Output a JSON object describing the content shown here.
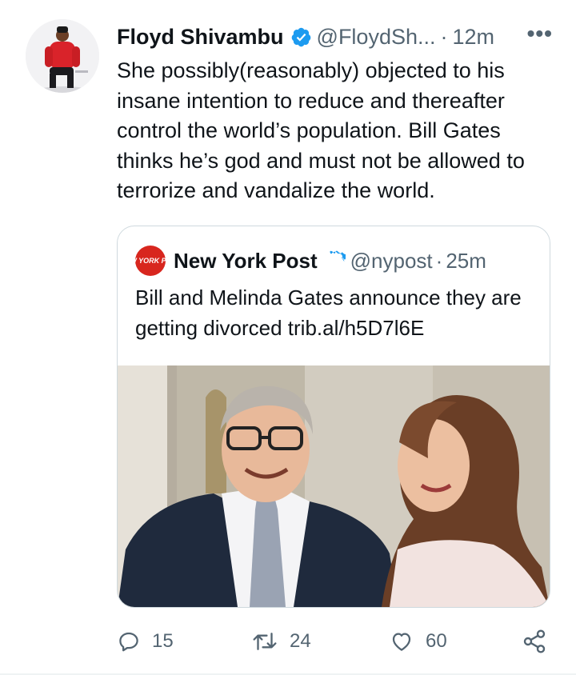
{
  "tweet": {
    "author_name": "Floyd Shivambu",
    "author_handle": "@FloydSh...",
    "separator": "·",
    "time": "12m",
    "more_menu": "•••",
    "text": "She possibly(reasonably) objected to his insane intention to reduce and thereafter control the world’s population. Bill Gates thinks he’s god and must not be allowed to terrorize and vandalize the world."
  },
  "quoted_tweet": {
    "author_name": "New York Post",
    "author_handle": "@nypost",
    "separator": "·",
    "time": "25m",
    "logo_text": "NEW YORK POST",
    "text": "Bill and Melinda Gates announce they are getting divorced trib.al/h5D7l6E"
  },
  "actions": {
    "replies": "15",
    "retweets": "24",
    "likes": "60"
  },
  "colors": {
    "verified": "#1d9bf0",
    "secondary_text": "#536471",
    "border": "#cfd9de",
    "nypost_red": "#d8261e"
  }
}
